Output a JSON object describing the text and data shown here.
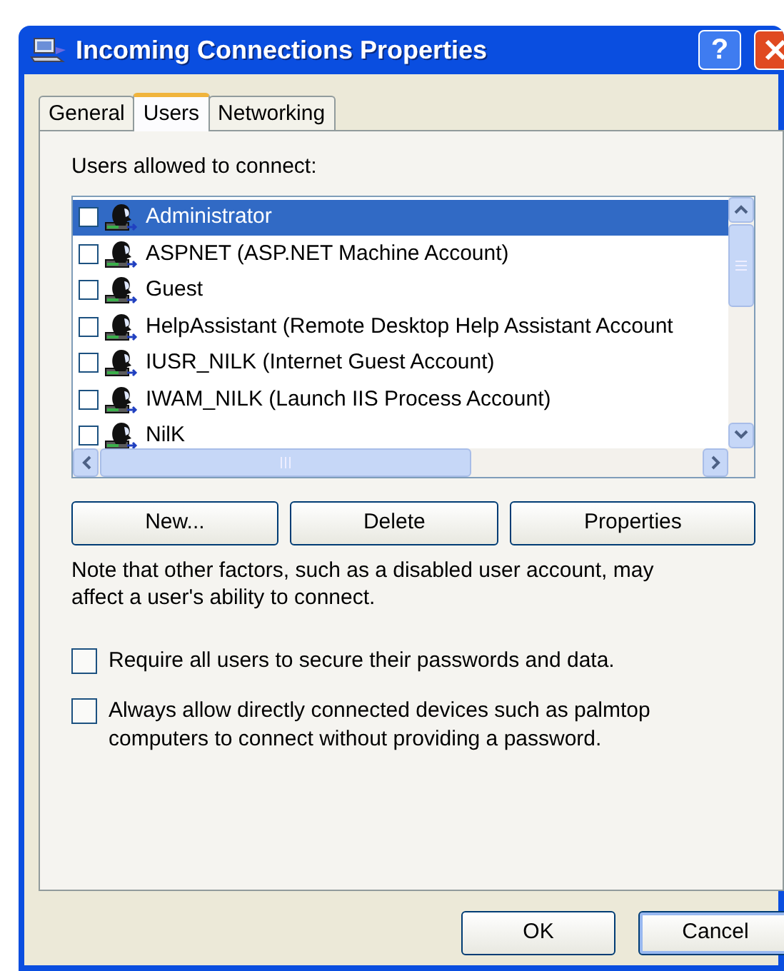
{
  "window": {
    "title": "Incoming Connections Properties",
    "help_button": "?"
  },
  "tabs": [
    {
      "label": "General",
      "selected": false
    },
    {
      "label": "Users",
      "selected": true
    },
    {
      "label": "Networking",
      "selected": false
    }
  ],
  "users_label": "Users allowed to connect:",
  "users": [
    {
      "name": "Administrator",
      "checked": false,
      "selected": true
    },
    {
      "name": "ASPNET (ASP.NET Machine Account)",
      "checked": false,
      "selected": false
    },
    {
      "name": "Guest",
      "checked": false,
      "selected": false
    },
    {
      "name": "HelpAssistant (Remote Desktop Help Assistant Account",
      "checked": false,
      "selected": false
    },
    {
      "name": "IUSR_NILK (Internet Guest Account)",
      "checked": false,
      "selected": false
    },
    {
      "name": "IWAM_NILK (Launch IIS Process Account)",
      "checked": false,
      "selected": false
    },
    {
      "name": "NilK",
      "checked": false,
      "selected": false
    }
  ],
  "user_buttons": [
    "New...",
    "Delete",
    "Properties"
  ],
  "note": "Note that other factors, such as a disabled user account, may affect a user's ability to connect.",
  "options": [
    {
      "label": "Require all users to secure their passwords and data.",
      "checked": false
    },
    {
      "label": "Always allow directly connected devices such as palmtop computers to connect without providing a password.",
      "checked": false
    }
  ],
  "dialog_buttons": [
    {
      "label": "OK",
      "focused": false
    },
    {
      "label": "Cancel",
      "focused": true
    }
  ]
}
